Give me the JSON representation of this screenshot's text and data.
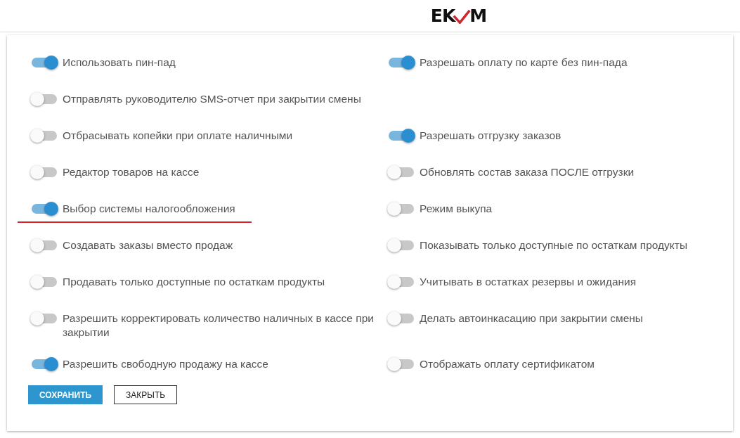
{
  "logo": {
    "before": "EK",
    "after": "M"
  },
  "rows": [
    {
      "cells": [
        {
          "label": "Использовать пин-пад",
          "on": true
        },
        {
          "label": "Разрешать оплату по карте без пин-пада",
          "on": true
        }
      ]
    },
    {
      "cells": [
        {
          "label": "Отправлять руководителю SMS-отчет при закрытии смены",
          "on": false
        }
      ]
    },
    {
      "cells": [
        {
          "label": "Отбрасывать копейки при оплате наличными",
          "on": false
        },
        {
          "label": "Разрешать отгрузку заказов",
          "on": true
        }
      ]
    },
    {
      "cells": [
        {
          "label": "Редактор товаров на кассе",
          "on": false
        },
        {
          "label": "Обновлять состав заказа ПОСЛЕ отгрузки",
          "on": false
        }
      ]
    },
    {
      "cells": [
        {
          "label": "Выбор системы налогообложения",
          "on": true,
          "underlined": true
        },
        {
          "label": "Режим выкупа",
          "on": false
        }
      ]
    },
    {
      "cells": [
        {
          "label": "Создавать заказы вместо продаж",
          "on": false
        },
        {
          "label": "Показывать только доступные по остаткам продукты",
          "on": false
        }
      ]
    },
    {
      "cells": [
        {
          "label": "Продавать только доступные по остаткам продукты",
          "on": false
        },
        {
          "label": "Учитывать в остатках резервы и ожидания",
          "on": false
        }
      ]
    },
    {
      "cells": [
        {
          "label": "Разрешить корректировать количество наличных в кассе при закрытии",
          "on": false
        },
        {
          "label": "Делать автоинкасацию при закрытии смены",
          "on": false
        }
      ]
    },
    {
      "cells": [
        {
          "label": "Разрешить свободную продажу на кассе",
          "on": true
        },
        {
          "label": "Отображать оплату сертификатом",
          "on": false
        }
      ]
    }
  ],
  "buttons": [
    {
      "label": "СОХРАНИТЬ",
      "kind": "primary"
    },
    {
      "label": "ЗАКРЫТЬ",
      "kind": "outline"
    }
  ]
}
